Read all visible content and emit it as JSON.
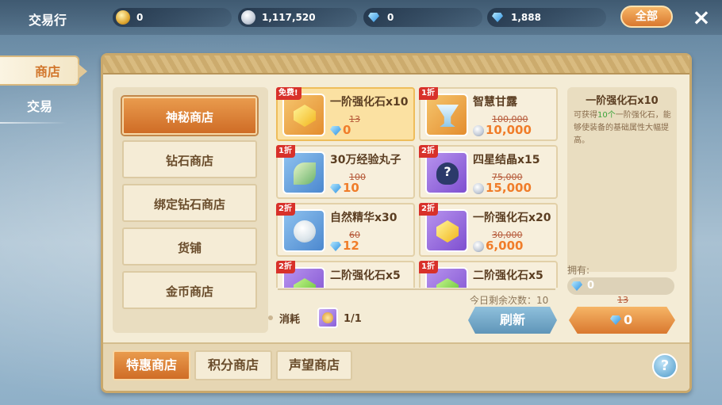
{
  "header": {
    "title": "交易行",
    "all_label": "全部",
    "close_icon": "×",
    "currencies": [
      {
        "icon": "gold-coin-icon",
        "value": "0"
      },
      {
        "icon": "silver-coin-icon",
        "value": "1,117,520"
      },
      {
        "icon": "diamond-icon",
        "value": "0"
      },
      {
        "icon": "bound-diamond-icon",
        "value": "1,888"
      }
    ]
  },
  "side_tabs": [
    {
      "label": "商店",
      "active": true
    },
    {
      "label": "交易",
      "active": false
    }
  ],
  "shop_nav": [
    {
      "label": "神秘商店",
      "active": true
    },
    {
      "label": "钻石商店",
      "active": false
    },
    {
      "label": "绑定钻石商店",
      "active": false
    },
    {
      "label": "货铺",
      "active": false
    },
    {
      "label": "金币商店",
      "active": false
    }
  ],
  "items": [
    {
      "tag": "免费!",
      "name": "一阶强化石x10",
      "old_price": "13",
      "price": "0",
      "currency": "diamond",
      "selected": true
    },
    {
      "tag": "1折",
      "name": "智慧甘露",
      "old_price": "100,000",
      "price": "10,000",
      "currency": "silver",
      "selected": false
    },
    {
      "tag": "1折",
      "name": "30万经验丸子",
      "old_price": "100",
      "price": "10",
      "currency": "diamond",
      "selected": false
    },
    {
      "tag": "2折",
      "name": "四星结晶x15",
      "old_price": "75,000",
      "price": "15,000",
      "currency": "silver",
      "selected": false
    },
    {
      "tag": "2折",
      "name": "自然精华x30",
      "old_price": "60",
      "price": "12",
      "currency": "diamond",
      "selected": false
    },
    {
      "tag": "2折",
      "name": "一阶强化石x20",
      "old_price": "30,000",
      "price": "6,000",
      "currency": "silver",
      "selected": false
    },
    {
      "tag": "2折",
      "name": "二阶强化石x5",
      "old_price": "",
      "price": "",
      "currency": "diamond",
      "selected": false
    },
    {
      "tag": "1折",
      "name": "二阶强化石x5",
      "old_price": "",
      "price": "",
      "currency": "silver",
      "selected": false
    }
  ],
  "remaining": "今日剩余次数：10",
  "consume": {
    "label": "消耗",
    "count": "1/1"
  },
  "refresh_label": "刷新",
  "detail": {
    "title": "一阶强化石x10",
    "desc_pre": "可获得",
    "desc_hl": "10个",
    "desc_post": "一阶强化石，能够使装备的基础属性大幅提高。",
    "own_label": "拥有:",
    "own_value": "0",
    "buy_old_price": "13",
    "buy_price": "0"
  },
  "bottom_tabs": [
    {
      "label": "特惠商店",
      "active": true
    },
    {
      "label": "积分商店",
      "active": false
    },
    {
      "label": "声望商店",
      "active": false
    }
  ],
  "help_label": "?"
}
